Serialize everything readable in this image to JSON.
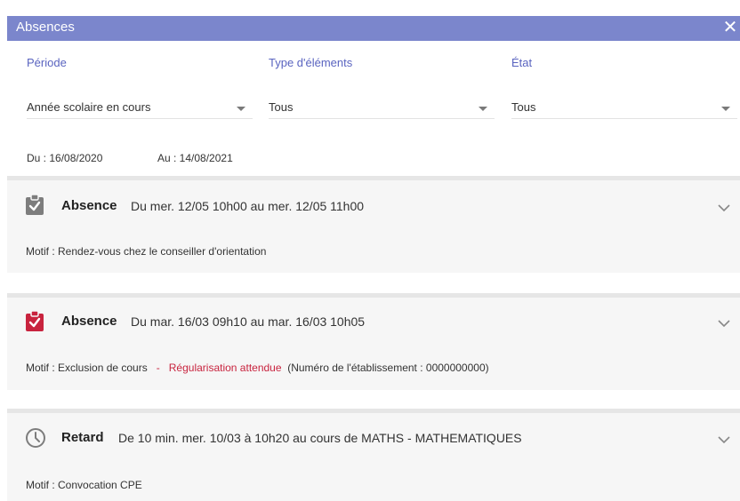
{
  "dialog": {
    "title": "Absences",
    "close_symbol": "✕"
  },
  "filters": {
    "periode_label": "Période",
    "type_label": "Type d'éléments",
    "etat_label": "État",
    "periode_value": "Année scolaire en cours",
    "type_value": "Tous",
    "etat_value": "Tous",
    "du": "Du : 16/08/2020",
    "au": "Au : 14/08/2021"
  },
  "entries": [
    {
      "icon": "clipboard-check-icon",
      "icon_color": "#7d7d7d",
      "kind": "Absence",
      "range": "Du mer. 12/05 10h00 au mer. 12/05 11h00",
      "motif": "Motif : Rendez-vous chez le conseiller d'orientation"
    },
    {
      "icon": "clipboard-check-icon",
      "icon_color": "#c8233e",
      "kind": "Absence",
      "range": "Du mar. 16/03 09h10 au mar. 16/03 10h05",
      "motif": "Motif : Exclusion de cours",
      "dash": "-",
      "status": "Régularisation attendue",
      "status_color": "#c8233e",
      "extra": "(Numéro de l'établissement : 0000000000)"
    },
    {
      "icon": "clock-icon",
      "icon_color": "#7d7d7d",
      "kind": "Retard",
      "range": "De 10 min. mer. 10/03 à 10h20 au cours de MATHS - MATHEMATIQUES",
      "motif": "Motif : Convocation CPE"
    }
  ],
  "colors": {
    "titlebar": "#7b86cc",
    "label": "#5a64c0",
    "card_bg": "#f6f6f6",
    "separator": "#e6e6e6"
  }
}
